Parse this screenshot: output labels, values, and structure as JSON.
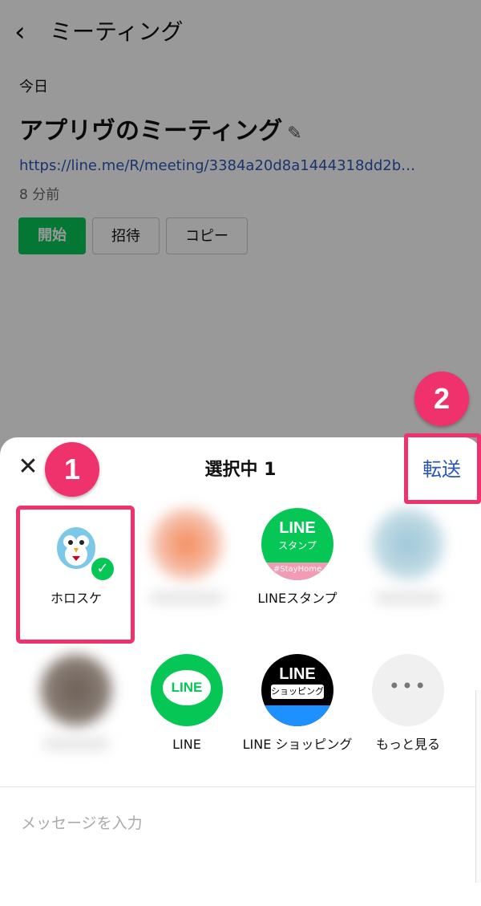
{
  "header": {
    "back_icon": "chevron-left-icon",
    "title": "ミーティング"
  },
  "meeting": {
    "date_label": "今日",
    "title": "アプリヴのミーティング",
    "url": "https://line.me/R/meeting/3384a20d8a1444318dd2b…",
    "time_ago": "8 分前",
    "buttons": {
      "start": "開始",
      "invite": "招待",
      "copy": "コピー"
    }
  },
  "sheet": {
    "close_icon": "close-icon",
    "title": "選択中 1",
    "forward_label": "転送",
    "contacts": [
      {
        "name": "ホロスケ",
        "selected": true
      },
      {
        "name": ""
      },
      {
        "name": "LINEスタンプ"
      },
      {
        "name": ""
      },
      {
        "name": ""
      },
      {
        "name": "LINE"
      },
      {
        "name": "LINE ショッピング"
      },
      {
        "name": "もっと見る"
      }
    ],
    "message_placeholder": "メッセージを入力"
  },
  "annotations": {
    "badge1": "1",
    "badge2": "2"
  },
  "colors": {
    "accent": "#06c755",
    "link": "#2a57b7",
    "highlight": "#f0326c"
  }
}
